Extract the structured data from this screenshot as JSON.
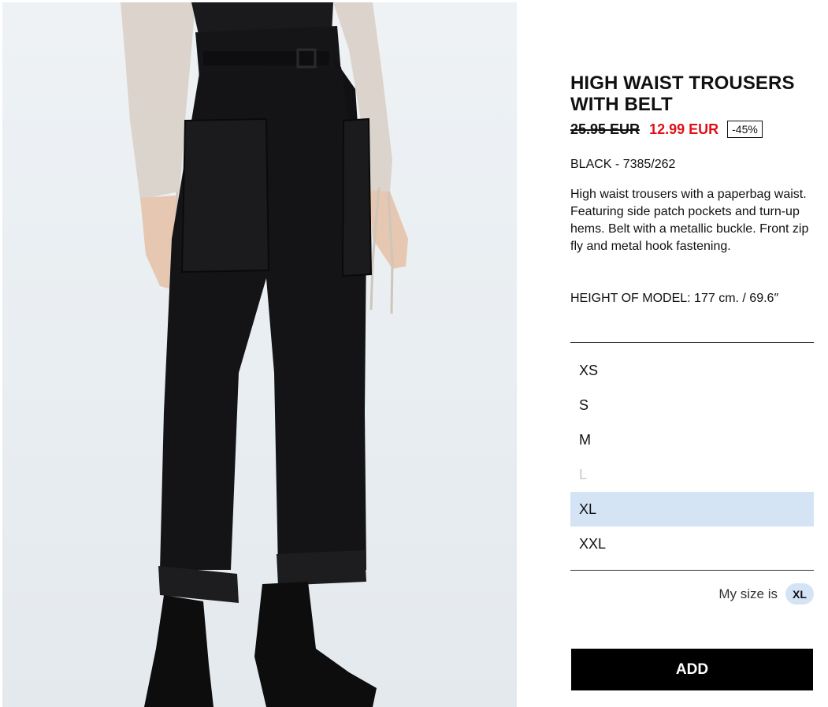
{
  "product": {
    "title": "HIGH WAIST TROUSERS WITH BELT",
    "old_price": "25.95 EUR",
    "new_price": "12.99 EUR",
    "discount": "-45%",
    "color_ref": "BLACK - 7385/262",
    "description": "High waist trousers with a paperbag waist. Featuring side patch pockets and turn-up hems. Belt with a metallic buckle. Front zip fly and metal hook fastening.",
    "model_height": "HEIGHT OF MODEL: 177 cm. / 69.6″"
  },
  "sizes": [
    {
      "label": "XS",
      "state": "available"
    },
    {
      "label": "S",
      "state": "available"
    },
    {
      "label": "M",
      "state": "available"
    },
    {
      "label": "L",
      "state": "disabled"
    },
    {
      "label": "XL",
      "state": "selected"
    },
    {
      "label": "XXL",
      "state": "available"
    }
  ],
  "my_size": {
    "label": "My size is",
    "value": "XL"
  },
  "add_button": {
    "label": "ADD"
  },
  "colors": {
    "sale": "#e0101a",
    "selected_bg": "#d4e4f5",
    "button_bg": "#000000"
  }
}
